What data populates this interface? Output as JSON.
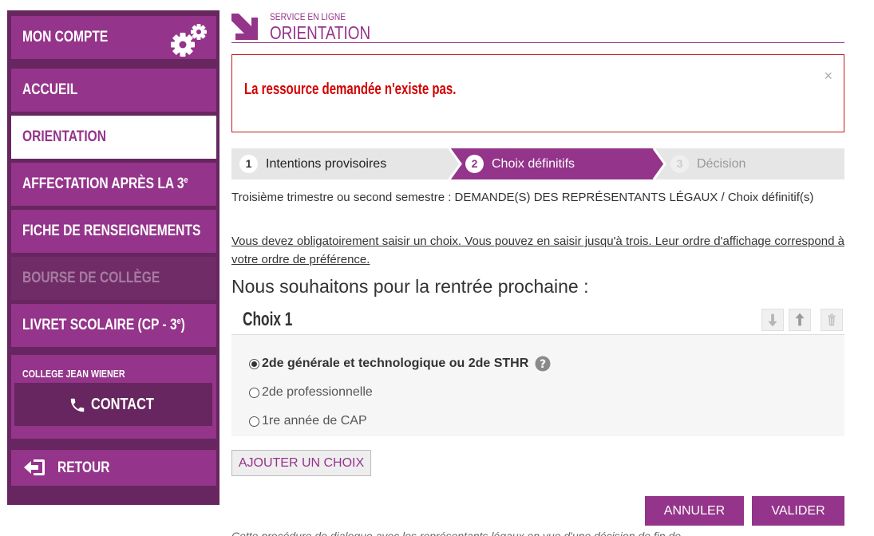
{
  "sidebar": {
    "account": "MON COMPTE",
    "items": [
      {
        "label": "ACCUEIL"
      },
      {
        "label": "ORIENTATION"
      },
      {
        "label": "AFFECTATION APRÈS LA 3",
        "sup": "e"
      },
      {
        "label": "FICHE DE RENSEIGNEMENTS"
      },
      {
        "label": "BOURSE DE COLLÈGE"
      },
      {
        "label": "LIVRET SCOLAIRE (CP - 3",
        "sup": "e",
        "suffix": ")"
      }
    ],
    "college_name": "COLLEGE JEAN WIENER",
    "contact": "CONTACT",
    "back": "RETOUR"
  },
  "header": {
    "service": "SERVICE EN LIGNE",
    "title": "ORIENTATION"
  },
  "alert": {
    "message": "La ressource demandée n'existe pas.",
    "close": "×"
  },
  "steps": [
    {
      "num": "1",
      "label": "Intentions provisoires",
      "state": "done"
    },
    {
      "num": "2",
      "label": "Choix définitifs",
      "state": "active"
    },
    {
      "num": "3",
      "label": "Décision",
      "state": "pending"
    }
  ],
  "intro": "Troisième trimestre ou second semestre : DEMANDE(S) DES REPRÉSENTANTS LÉGAUX / Choix définitif(s)",
  "notice": "Vous devez obligatoirement saisir un choix. Vous pouvez en saisir jusqu'à trois. Leur ordre d'affichage correspond à votre ordre de préférence.",
  "wish_heading": "Nous souhaitons pour la rentrée prochaine :",
  "choice": {
    "title": "Choix 1",
    "options": [
      {
        "label": "2de générale et technologique ou 2de STHR",
        "checked": true
      },
      {
        "label": "2de professionnelle",
        "checked": false
      },
      {
        "label": "1re année de CAP",
        "checked": false
      }
    ]
  },
  "buttons": {
    "add": "AJOUTER UN CHOIX",
    "cancel": "ANNULER",
    "validate": "VALIDER"
  },
  "footnote": "Cette procédure de dialogue avec les représentants légaux en vue d'une décision de fin de",
  "colors": {
    "brand": "#94348a",
    "brand_dark": "#67265f",
    "error": "#d40000"
  }
}
